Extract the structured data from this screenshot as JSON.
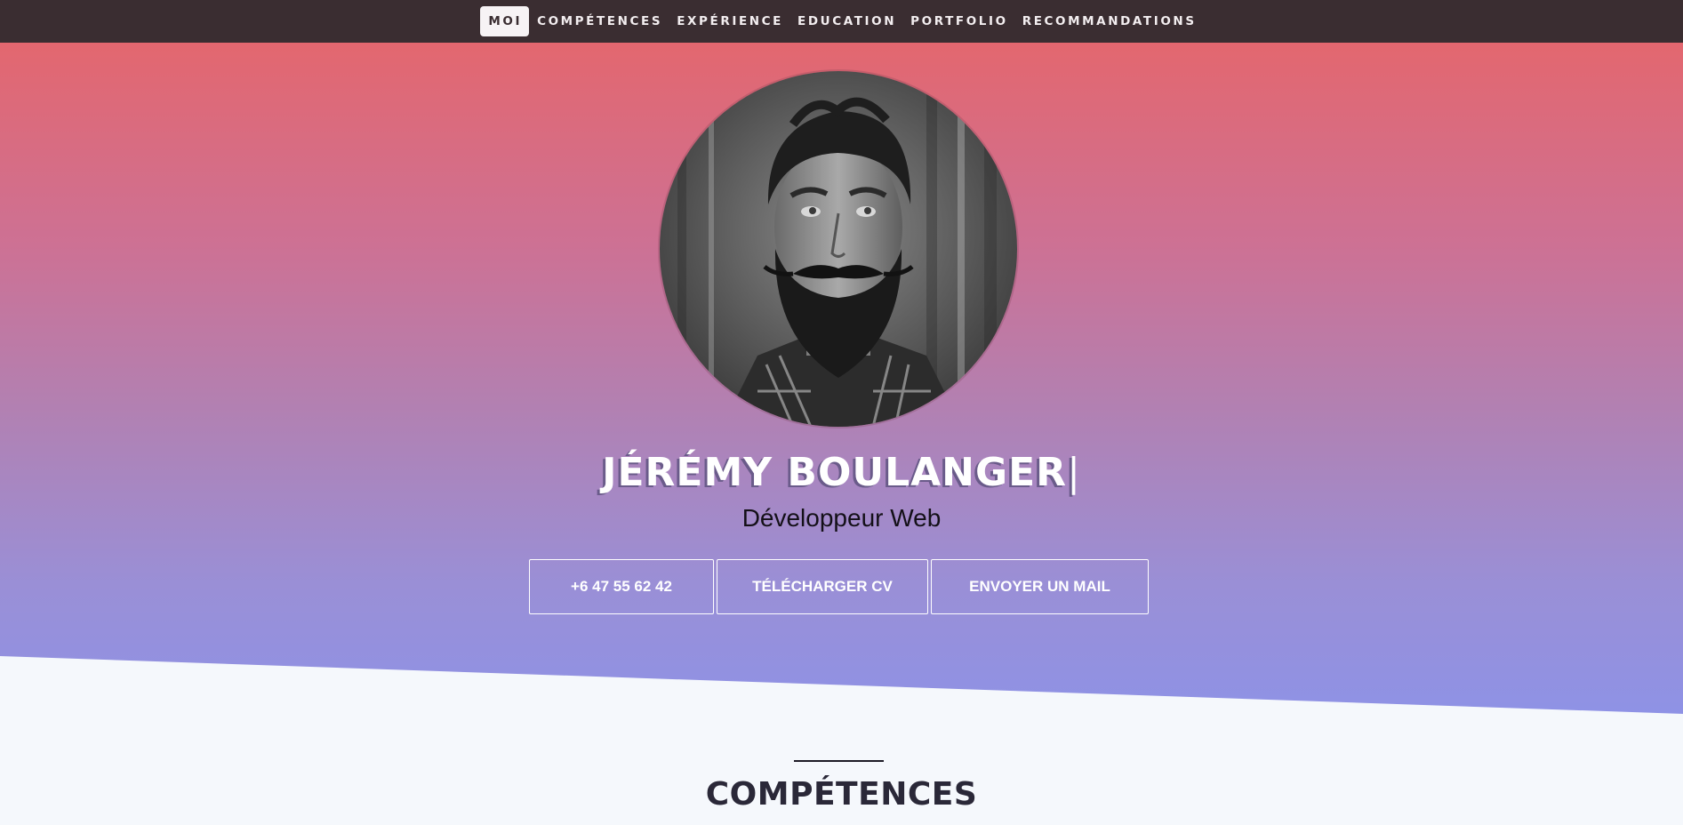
{
  "nav": {
    "items": [
      {
        "label": "MOI",
        "active": true
      },
      {
        "label": "COMPÉTENCES"
      },
      {
        "label": "EXPÉRIENCE"
      },
      {
        "label": "EDUCATION"
      },
      {
        "label": "PORTFOLIO"
      },
      {
        "label": "RECOMMANDATIONS"
      }
    ]
  },
  "hero": {
    "name": "JÉRÉMY BOULANGER",
    "cursor": "|",
    "subtitle": "Développeur Web",
    "buttons": {
      "phone": "+6 47 55 62 42",
      "cv": "TÉLÉCHARGER CV",
      "mail": "ENVOYER UN MAIL"
    },
    "gradient_colors": [
      "#e3676f",
      "#cd7194",
      "#b181b3",
      "#9a8fd6",
      "#8e92e6"
    ]
  },
  "sections": {
    "skills_title": "COMPÉTENCES"
  },
  "colors": {
    "navbar_bg": "#3a2d31",
    "page_bg": "#f5f8fc",
    "title_dark": "#2a2838"
  }
}
